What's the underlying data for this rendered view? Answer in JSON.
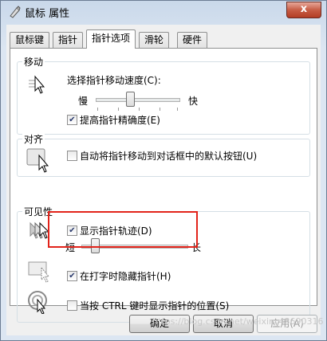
{
  "window": {
    "title": "鼠标 属性",
    "close": "x"
  },
  "tabs": [
    {
      "label": "鼠标键"
    },
    {
      "label": "指针"
    },
    {
      "label": "指针选项",
      "active": true
    },
    {
      "label": "滑轮"
    },
    {
      "label": "硬件"
    }
  ],
  "motion": {
    "title": "移动",
    "speed_label": "选择指针移动速度(C):",
    "slow": "慢",
    "fast": "快",
    "speed_level": 0.45,
    "precision_label": "提高指针精确度(E)",
    "precision_checked": true
  },
  "snap": {
    "title": "对齐",
    "snap_label": "自动将指针移动到对话框中的默认按钮(U)",
    "snap_checked": false
  },
  "visibility": {
    "title": "可见性",
    "trails_label": "显示指针轨迹(D)",
    "trails_checked": true,
    "short": "短",
    "long": "长",
    "trails_level": 0.1,
    "hide_label": "在打字时隐藏指针(H)",
    "hide_checked": true,
    "ctrl_label": "当按 CTRL 键时显示指针的位置(S)",
    "ctrl_checked": false
  },
  "buttons": {
    "ok": "确定",
    "cancel": "取消",
    "apply": "应用(A)"
  },
  "watermark": "https://blog.csdn.net/weixin_43690316",
  "colors": {
    "highlight": "#e2231a",
    "accent": "#2b3b6e"
  }
}
